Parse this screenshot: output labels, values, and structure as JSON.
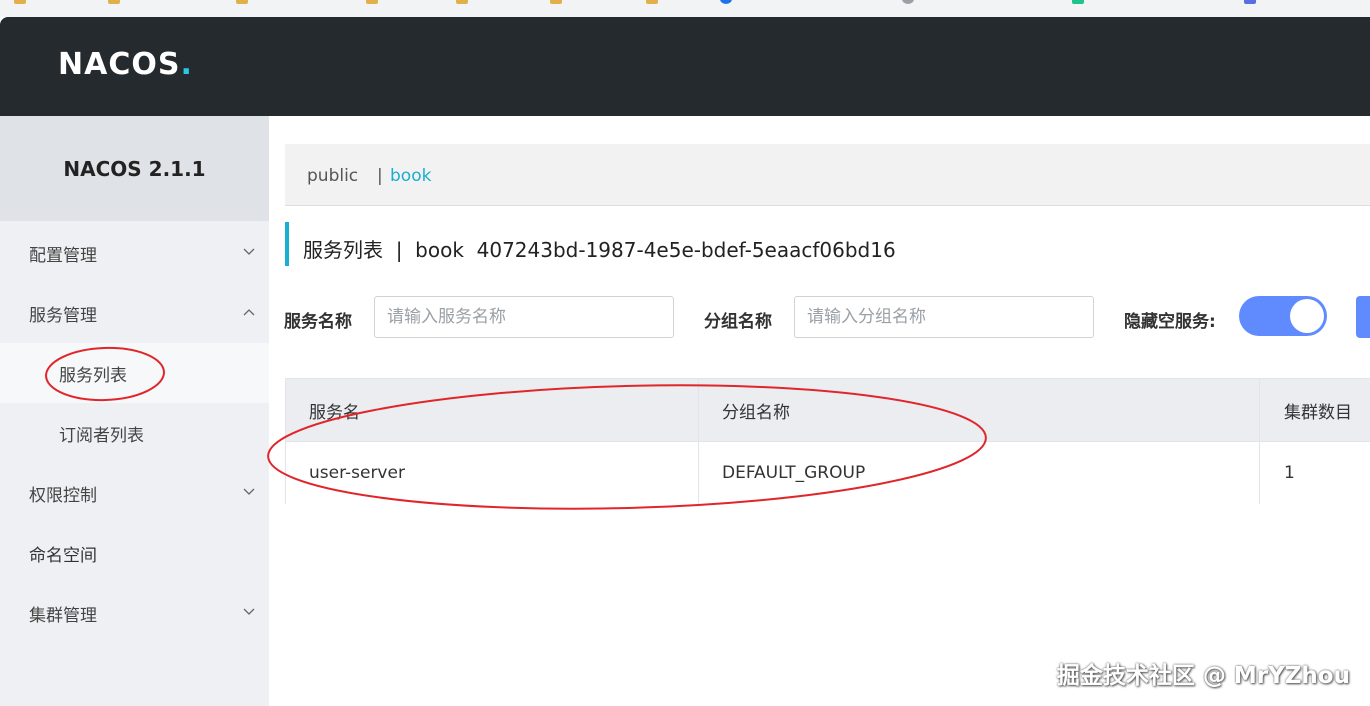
{
  "header": {
    "logo_text": "NACOS",
    "logo_dot": "."
  },
  "sidebar": {
    "version_title": "NACOS 2.1.1",
    "items": [
      {
        "label": "配置管理",
        "expanded": false
      },
      {
        "label": "服务管理",
        "expanded": true
      },
      {
        "label": "服务列表"
      },
      {
        "label": "订阅者列表"
      },
      {
        "label": "权限控制",
        "expanded": false
      },
      {
        "label": "命名空间"
      },
      {
        "label": "集群管理",
        "expanded": false
      }
    ]
  },
  "breadcrumb": {
    "namespace_public": "public",
    "separator": "|",
    "namespace_book": "book"
  },
  "page": {
    "title": "服务列表  |  book  407243bd-1987-4e5e-bdef-5eaacf06bd16"
  },
  "filters": {
    "service_name_label": "服务名称",
    "service_name_placeholder": "请输入服务名称",
    "service_name_value": "",
    "group_name_label": "分组名称",
    "group_name_placeholder": "请输入分组名称",
    "group_name_value": "",
    "hide_empty_label": "隐藏空服务:",
    "hide_empty_on": true
  },
  "table": {
    "columns": [
      "服务名",
      "分组名称",
      "集群数目"
    ],
    "rows": [
      [
        "user-server",
        "DEFAULT_GROUP",
        "1"
      ]
    ]
  },
  "watermark": "掘金技术社区 @ MrYZhou",
  "colors": {
    "header_bg": "#252a2f",
    "accent": "#1aafd0",
    "toggle": "#5f8bff",
    "annotation": "#e0262b"
  }
}
